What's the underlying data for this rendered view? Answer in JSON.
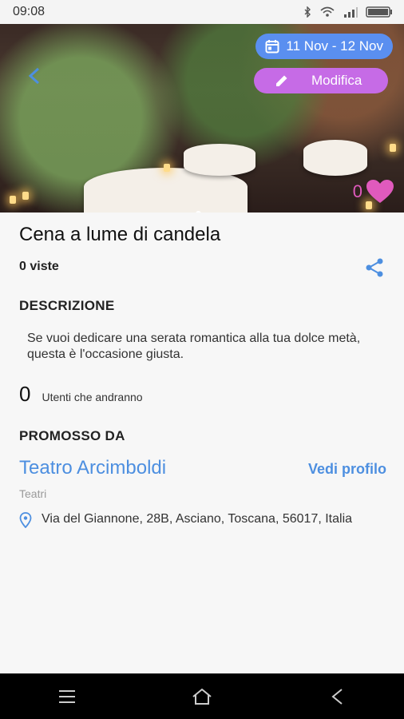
{
  "status": {
    "time": "09:08"
  },
  "event": {
    "date_range": "11 Nov - 12 Nov",
    "edit_label": "Modifica",
    "likes": "0",
    "title": "Cena a lume di candela",
    "views": "0 viste",
    "description_heading": "DESCRIZIONE",
    "description": "Se vuoi dedicare una serata romantica alla tua dolce metà, questa è l'occasione giusta.",
    "attendees_count": "0",
    "attendees_label": "Utenti che andranno",
    "promoted_heading": "PROMOSSO DA"
  },
  "organizer": {
    "name": "Teatro Arcimboldi",
    "profile_link": "Vedi profilo",
    "category": "Teatri",
    "address": "Via del Giannone, 28B, Asciano, Toscana, 56017, Italia"
  },
  "colors": {
    "accent": "#4d8fe0",
    "date_chip": "#5a8ff0",
    "edit_chip": "#c66be6",
    "heart": "#e05abd"
  },
  "icons": [
    "back-icon",
    "calendar-icon",
    "pencil-icon",
    "heart-icon",
    "share-icon",
    "location-pin-icon",
    "bluetooth-icon",
    "wifi-icon",
    "signal-icon",
    "battery-icon",
    "menu-icon",
    "home-icon",
    "back-nav-icon"
  ]
}
